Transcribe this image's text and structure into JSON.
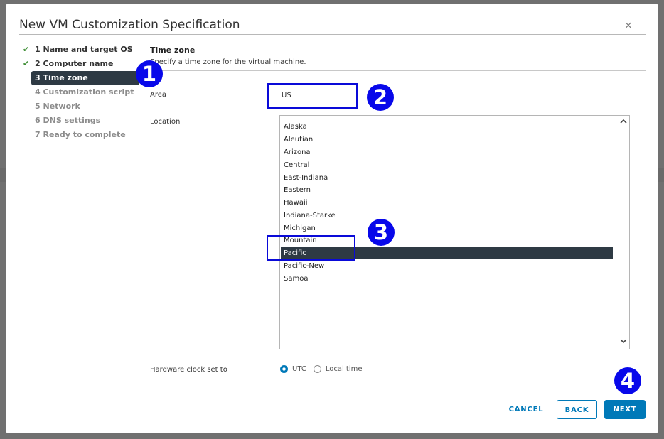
{
  "dialog": {
    "title": "New VM Customization Specification",
    "close_glyph": "×"
  },
  "steps": [
    {
      "label": "1 Name and target OS",
      "state": "done"
    },
    {
      "label": "2 Computer name",
      "state": "done"
    },
    {
      "label": "3 Time zone",
      "state": "active"
    },
    {
      "label": "4 Customization script",
      "state": "pending"
    },
    {
      "label": "5 Network",
      "state": "pending"
    },
    {
      "label": "6 DNS settings",
      "state": "pending"
    },
    {
      "label": "7 Ready to complete",
      "state": "pending"
    }
  ],
  "check_glyph": "✔",
  "section": {
    "title": "Time zone",
    "subtitle": "Specify a time zone for the virtual machine."
  },
  "area": {
    "label": "Area",
    "value": "US"
  },
  "location": {
    "label": "Location",
    "options": [
      "Alaska",
      "Aleutian",
      "Arizona",
      "Central",
      "East-Indiana",
      "Eastern",
      "Hawaii",
      "Indiana-Starke",
      "Michigan",
      "Mountain",
      "Pacific",
      "Pacific-New",
      "Samoa"
    ],
    "selected": "Pacific"
  },
  "clock": {
    "label": "Hardware clock set to",
    "options": [
      "UTC",
      "Local time"
    ],
    "selected": "UTC"
  },
  "buttons": {
    "cancel": "CANCEL",
    "back": "BACK",
    "next": "NEXT"
  },
  "annotations": [
    "1",
    "2",
    "3",
    "4"
  ],
  "colors": {
    "accent": "#0079b8",
    "active_step": "#2e3a44",
    "annotation": "#0808ea",
    "check": "#3c8d33"
  }
}
